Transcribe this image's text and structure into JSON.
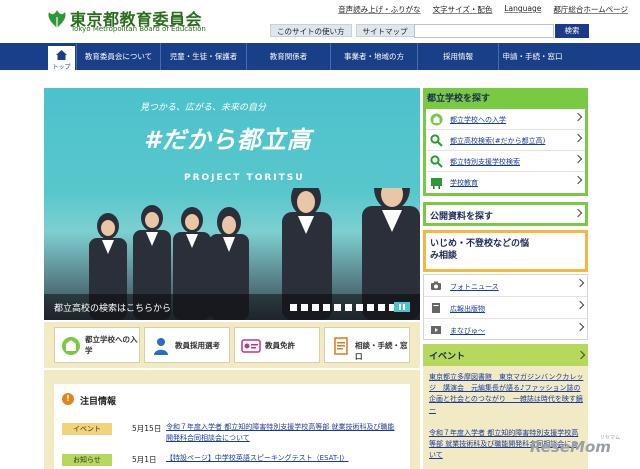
{
  "header": {
    "logo_ja": "東京都教育委員会",
    "logo_en": "Tokyo Metropolitan Board of Education",
    "util_links": [
      "音声読み上げ・ふりがな",
      "文字サイズ・配色",
      "Language",
      "都庁総合ホームページ"
    ],
    "subnav": [
      "このサイトの使い方",
      "サイトマップ"
    ],
    "search_placeholder": "",
    "search_button": "検索",
    "brand_color": "#2a6e1d"
  },
  "gnav": {
    "home_label": "トップ",
    "items": [
      "教育委員会について",
      "児童・生徒・保護者",
      "教育関係者",
      "事業者・地域の方",
      "採用情報",
      "申請・手続・窓口"
    ],
    "color": "#1a3f89"
  },
  "hero": {
    "subtitle": "見つかる、広がる、未来の自分",
    "title": "#だから都立高",
    "project": "PROJECT TORITSU",
    "caption": "都立高校の検索はこちらから"
  },
  "quick": [
    {
      "label": "都立学校への入学",
      "icon": "school-icon"
    },
    {
      "label": "教員採用選考",
      "icon": "teacher-icon"
    },
    {
      "label": "教員免許",
      "icon": "license-icon"
    },
    {
      "label": "相談・手続・窓口",
      "icon": "document-icon"
    }
  ],
  "news": {
    "title": "注目情報",
    "items": [
      {
        "tag": "イベント",
        "date": "5月15日",
        "text": "令和７年度入学者 都立知的障害特別支援学校高等部 就業技術科及び職能開発科合同相談会について"
      },
      {
        "tag": "お知らせ",
        "date": "5月1日",
        "text": "【特設ページ】中学校英語スピーキングテスト（ESAT-J）"
      }
    ]
  },
  "right": {
    "school_search_title": "都立学校を探す",
    "school_items": [
      "都立学校への入学",
      "都立高校検索(#だから都立高)",
      "都立特別支援学校検索",
      "学校教育"
    ],
    "public_docs": "公開資料を探す",
    "bullying": "いじめ・不登校などの悩み相談",
    "links": [
      "フォトニュース",
      "広報出版物",
      "まなびゅ～"
    ],
    "event_title": "イベント",
    "event_text": "東京都立多摩図書館　東京マガジンバンクカレッジ　講演会　元編集長が語る♪ファッション誌の企画と社会とのつながり　一雑誌は時代を映す鏡ー",
    "event_text2": "令和７年度入学者 都立知的障害特別支援学校高等部 就業技術科及び職能開発科合同相談会について"
  },
  "watermark": "ReseMom",
  "watermark_sub": "リセマム"
}
